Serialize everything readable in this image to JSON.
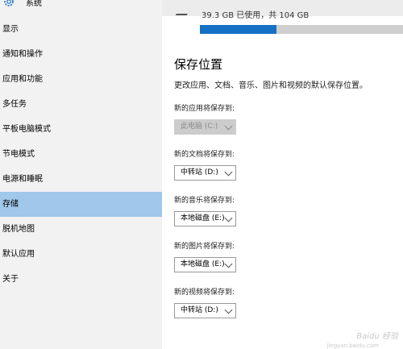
{
  "window": {
    "title": "系统"
  },
  "sidebar": {
    "items": [
      {
        "label": "显示"
      },
      {
        "label": "通知和操作"
      },
      {
        "label": "应用和功能"
      },
      {
        "label": "多任务"
      },
      {
        "label": "平板电脑模式"
      },
      {
        "label": "节电模式"
      },
      {
        "label": "电源和睡眠"
      },
      {
        "label": "存储",
        "active": true
      },
      {
        "label": "脱机地图"
      },
      {
        "label": "默认应用"
      },
      {
        "label": "关于"
      }
    ]
  },
  "storage": {
    "usage_text": "39.3 GB 已使用，共 104 GB",
    "used_fraction": 0.378
  },
  "save_locations": {
    "title": "保存位置",
    "description": "更改应用、文档、音乐、图片和视频的默认保存位置。",
    "fields": [
      {
        "label": "新的应用将保存到:",
        "value": "此电脑 (C:)",
        "disabled": true
      },
      {
        "label": "新的文档将保存到:",
        "value": "中转站 (D:)"
      },
      {
        "label": "新的音乐将保存到:",
        "value": "本地磁盘 (E:)"
      },
      {
        "label": "新的图片将保存到:",
        "value": "本地磁盘 (E:)"
      },
      {
        "label": "新的视频将保存到:",
        "value": "中转站 (D:)"
      }
    ]
  },
  "watermark": {
    "text": "Baidu 经验",
    "sub": "jingyan.baidu.com"
  },
  "colors": {
    "accent": "#1670c6",
    "active_nav": "#9fc8ea",
    "sidebar_bg": "#f2f2f2"
  }
}
